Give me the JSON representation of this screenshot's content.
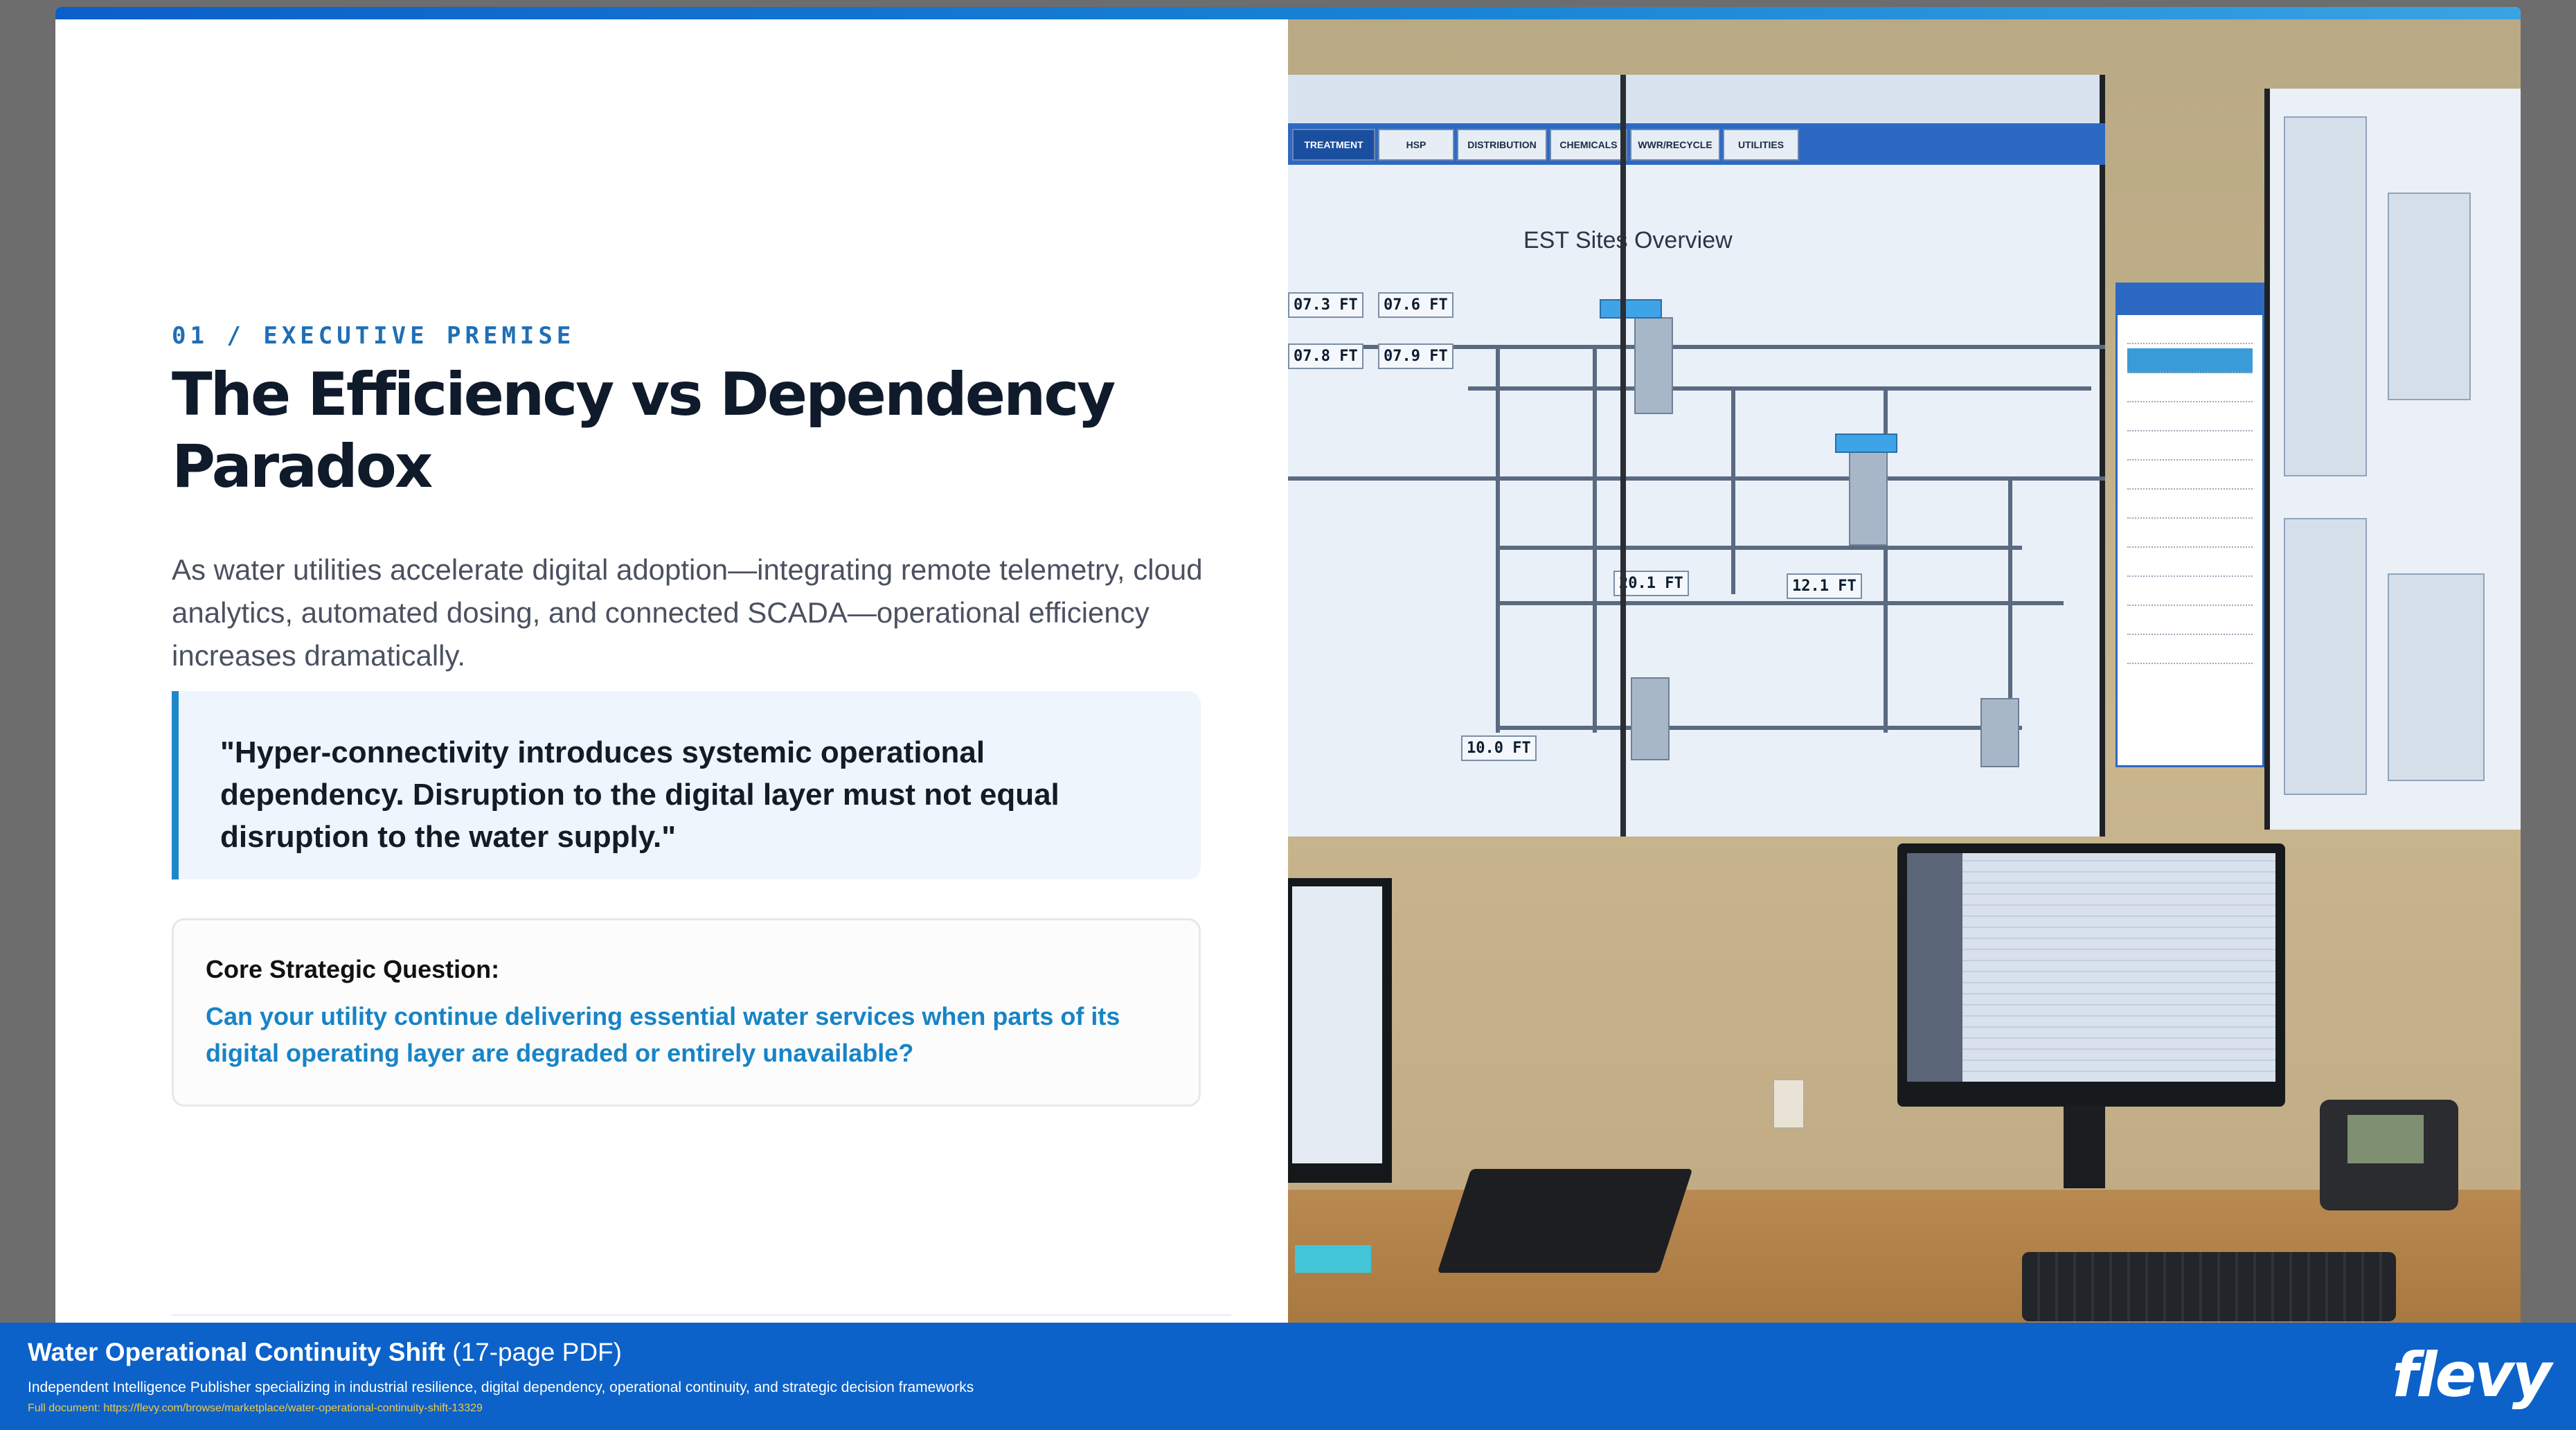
{
  "slide": {
    "eyebrow": "01 / EXECUTIVE PREMISE",
    "title": "The Efficiency vs Dependency Paradox",
    "lead": "As water utilities accelerate digital adoption—integrating remote telemetry, cloud analytics, automated dosing, and connected SCADA—operational efficiency increases dramatically.",
    "quote": "\"Hyper-connectivity introduces systemic operational dependency. Disruption to the digital layer must not equal disruption to the water supply.\"",
    "question_label": "Core Strategic Question:",
    "question_text": "Can your utility continue delivering essential water services when parts of its digital operating layer are degraded or entirely unavailable?"
  },
  "photo": {
    "tabs": [
      "TREATMENT",
      "HSP",
      "DISTRIBUTION",
      "CHEMICALS",
      "WWR/RECYCLE",
      "UTILITIES"
    ],
    "screen_title": "EST Sites Overview",
    "levels": [
      "07.3 FT",
      "07.6 FT",
      "07.8 FT",
      "07.9 FT",
      "20.1 FT",
      "12.1 FT",
      "10.0 FT"
    ]
  },
  "footer": {
    "title": "Water Operational Continuity Shift",
    "pages": "(17-page PDF)",
    "description": "Independent Intelligence Publisher specializing in industrial resilience, digital dependency, operational continuity, and strategic decision frameworks",
    "link": "Full document: https://flevy.com/browse/marketplace/water-operational-continuity-shift-13329",
    "logo": "flevy"
  },
  "colors": {
    "accent": "#1f86c9",
    "footer_bg": "#0c62c9",
    "title": "#0f1a2b"
  }
}
